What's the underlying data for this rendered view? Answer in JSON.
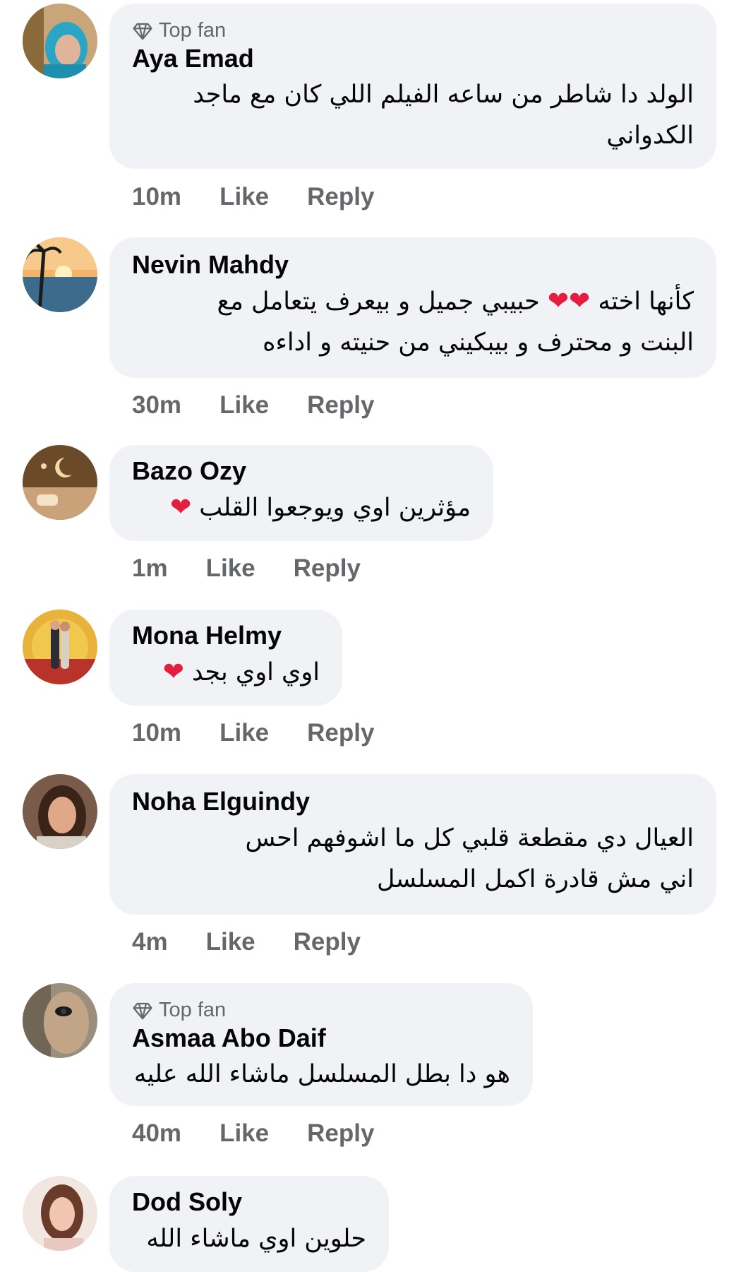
{
  "top_fan_label": "Top fan",
  "comments": [
    {
      "name": "Aya Emad",
      "top_fan": true,
      "lines": [
        "الولد دا شاطر من ساعه الفيلم اللي كان مع ماجد",
        "الكدواني"
      ],
      "time": "10m",
      "like": "Like",
      "reply": "Reply"
    },
    {
      "name": "Nevin Mahdy",
      "top_fan": false,
      "lines": [
        "كأنها اخته ❤️❤️ حبيبي جميل و بيعرف يتعامل مع",
        "البنت و محترف و بيبكيني من حنيته و اداءه"
      ],
      "time": "30m",
      "like": "Like",
      "reply": "Reply"
    },
    {
      "name": "Bazo Ozy",
      "top_fan": false,
      "lines": [
        "مؤثرين اوي ويوجعوا القلب ❤️"
      ],
      "time": "1m",
      "like": "Like",
      "reply": "Reply"
    },
    {
      "name": "Mona Helmy",
      "top_fan": false,
      "lines": [
        "اوي اوي بجد ❤️"
      ],
      "time": "10m",
      "like": "Like",
      "reply": "Reply"
    },
    {
      "name": "Noha Elguindy",
      "top_fan": false,
      "lines": [
        "العيال دي مقطعة قلبي  كل ما اشوفهم احس",
        "اني مش قادرة اكمل المسلسل"
      ],
      "time": "4m",
      "like": "Like",
      "reply": "Reply"
    },
    {
      "name": "Asmaa Abo Daif",
      "top_fan": true,
      "lines": [
        "هو دا بطل المسلسل ماشاء الله عليه"
      ],
      "time": "40m",
      "like": "Like",
      "reply": "Reply"
    },
    {
      "name": "Dod Soly",
      "top_fan": false,
      "lines": [
        "حلوين اوي ماشاء الله"
      ],
      "time": "",
      "like": "",
      "reply": ""
    }
  ],
  "colors": {
    "bubble": "#f0f2f5",
    "meta_text": "#65676b",
    "name_text": "#050505",
    "heart": "#e41e3f"
  }
}
